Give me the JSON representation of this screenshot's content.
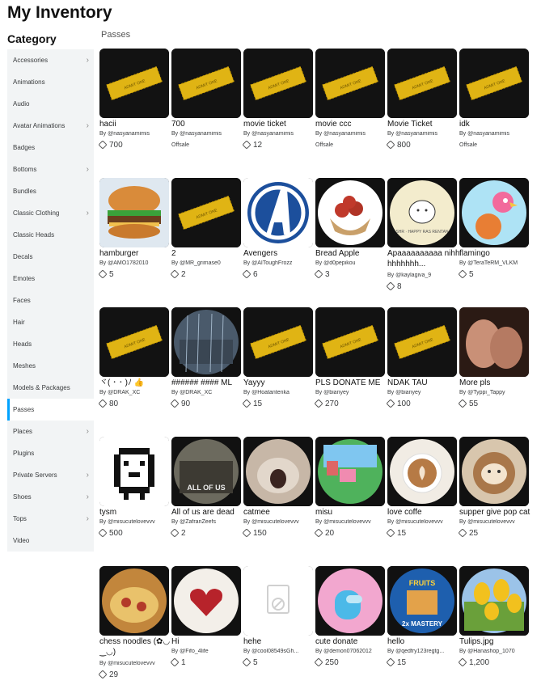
{
  "page_title": "My Inventory",
  "category_title": "Category",
  "section_label": "Passes",
  "sidebar": [
    {
      "label": "Accessories",
      "chevron": true
    },
    {
      "label": "Animations",
      "chevron": false
    },
    {
      "label": "Audio",
      "chevron": false
    },
    {
      "label": "Avatar Animations",
      "chevron": true
    },
    {
      "label": "Badges",
      "chevron": false
    },
    {
      "label": "Bottoms",
      "chevron": true
    },
    {
      "label": "Bundles",
      "chevron": false
    },
    {
      "label": "Classic Clothing",
      "chevron": true
    },
    {
      "label": "Classic Heads",
      "chevron": false
    },
    {
      "label": "Decals",
      "chevron": false
    },
    {
      "label": "Emotes",
      "chevron": false
    },
    {
      "label": "Faces",
      "chevron": false
    },
    {
      "label": "Hair",
      "chevron": false
    },
    {
      "label": "Heads",
      "chevron": false
    },
    {
      "label": "Meshes",
      "chevron": false
    },
    {
      "label": "Models & Packages",
      "chevron": false
    },
    {
      "label": "Passes",
      "chevron": false,
      "active": true
    },
    {
      "label": "Places",
      "chevron": true
    },
    {
      "label": "Plugins",
      "chevron": false
    },
    {
      "label": "Private Servers",
      "chevron": true
    },
    {
      "label": "Shoes",
      "chevron": true
    },
    {
      "label": "Tops",
      "chevron": true
    },
    {
      "label": "Video",
      "chevron": false
    }
  ],
  "by_prefix": "By ",
  "items": [
    {
      "name": "hacii",
      "creator": "@nasyanamimis",
      "price": "700",
      "thumb": "ticket"
    },
    {
      "name": "700",
      "creator": "@nasyanamimis",
      "offsale": "Offsale",
      "thumb": "ticket"
    },
    {
      "name": "movie ticket",
      "creator": "@nasyanamimis",
      "price": "12",
      "thumb": "ticket"
    },
    {
      "name": "movie ccc",
      "creator": "@nasyanamimis",
      "offsale": "Offsale",
      "thumb": "ticket"
    },
    {
      "name": "Movie Ticket",
      "creator": "@nasyanamimis",
      "price": "800",
      "thumb": "ticket"
    },
    {
      "name": "idk",
      "creator": "@nasyanamimis",
      "offsale": "Offsale",
      "thumb": "ticket"
    },
    {
      "name": "hamburger",
      "creator": "@AMO1782010",
      "price": "5",
      "thumb": "burger"
    },
    {
      "name": "2",
      "creator": "@MR_grimase0",
      "price": "2",
      "thumb": "ticket"
    },
    {
      "name": "Avengers",
      "creator": "@AIToughFrozz",
      "price": "6",
      "thumb": "avengers"
    },
    {
      "name": "Bread Apple",
      "creator": "@d0pepikou",
      "price": "3",
      "thumb": "bread"
    },
    {
      "name": "Apaaaaaaaaaa nihhhhhhhhh...",
      "creator": "@kaylagiva_9",
      "price": "8",
      "thumb": "sticker"
    },
    {
      "name": "flamingo",
      "creator": "@TeraTeRM_VLKM",
      "price": "5",
      "thumb": "flamingo"
    },
    {
      "name": "ヾ( ･ ･ )ﾉ 👍",
      "creator": "@DRAK_XC",
      "price": "80",
      "thumb": "ticket"
    },
    {
      "name": "###### #### ML",
      "creator": "@DRAK_XC",
      "price": "90",
      "thumb": "rain"
    },
    {
      "name": "Yayyy",
      "creator": "@Hoatantenka",
      "price": "15",
      "thumb": "ticket"
    },
    {
      "name": "PLS DONATE ME",
      "creator": "@bianyey",
      "price": "270",
      "thumb": "ticket"
    },
    {
      "name": "NDAK TAU",
      "creator": "@bianyey",
      "price": "100",
      "thumb": "ticket"
    },
    {
      "name": "More pls",
      "creator": "@Typpi_Tappy",
      "price": "55",
      "thumb": "hands"
    },
    {
      "name": "tysm",
      "creator": "@misucutelovevvv",
      "price": "500",
      "thumb": "pixel"
    },
    {
      "name": "All of us are dead",
      "creator": "@ZafranZeefs",
      "price": "2",
      "thumb": "movie"
    },
    {
      "name": "catmee",
      "creator": "@misucutelovevvv",
      "price": "150",
      "thumb": "cat"
    },
    {
      "name": "misu",
      "creator": "@misucutelovevvv",
      "price": "20",
      "thumb": "game"
    },
    {
      "name": "love coffe",
      "creator": "@misucutelovevvv",
      "price": "15",
      "thumb": "coffee"
    },
    {
      "name": "supper give pop cat",
      "creator": "@misucutelovevvv",
      "price": "25",
      "thumb": "coffeecat"
    },
    {
      "name": "chess noodles (✿◡‿◡)",
      "creator": "@misucutelovevvv",
      "price": "29",
      "thumb": "noodles"
    },
    {
      "name": "Hi",
      "creator": "@Fifo_4life",
      "price": "1",
      "thumb": "heart"
    },
    {
      "name": "hehe",
      "creator": "@cool08549sGh...",
      "price": "5",
      "thumb": "blank"
    },
    {
      "name": "cute donate",
      "creator": "@demon07062012",
      "price": "250",
      "thumb": "amongus"
    },
    {
      "name": "hello",
      "creator": "@qedfry123regtg...",
      "price": "15",
      "thumb": "fruits"
    },
    {
      "name": "Tulips.jpg",
      "creator": "@Hanashop_1070",
      "price": "1,200",
      "thumb": "tulips"
    }
  ]
}
